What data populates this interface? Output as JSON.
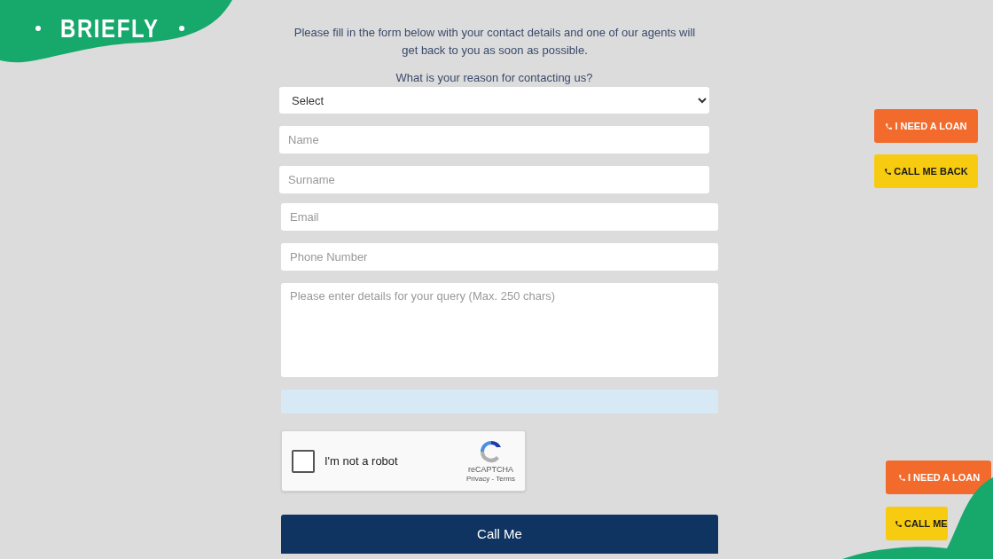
{
  "logo": {
    "text": "BRIEFLY"
  },
  "intro": "Please fill in the form below with your contact details and one of our agents will get back to you as soon as possible.",
  "reason": {
    "label": "What is your reason for contacting us?",
    "value": "Select"
  },
  "fields": [
    {
      "kind": "input",
      "placeholder": "Name"
    },
    {
      "kind": "input",
      "placeholder": "Surname"
    },
    {
      "kind": "input",
      "placeholder": "Email"
    },
    {
      "kind": "input",
      "placeholder": "Phone Number"
    },
    {
      "kind": "textarea",
      "placeholder": "Please enter details for your query (Max. 250 chars)"
    }
  ],
  "captcha": {
    "label": "I'm not a robot",
    "checked": false,
    "brand": "reCAPTCHA",
    "links": "Privacy - Terms"
  },
  "submit": "Call Me",
  "side_buttons": [
    {
      "label": "I NEED A LOAN",
      "kind": "loan"
    },
    {
      "label": "CALL ME BACK",
      "kind": "callback"
    }
  ],
  "bottom_buttons": [
    {
      "label": "I NEED A LOAN",
      "kind": "loan"
    },
    {
      "label": "CALL ME",
      "kind": "callback"
    }
  ]
}
